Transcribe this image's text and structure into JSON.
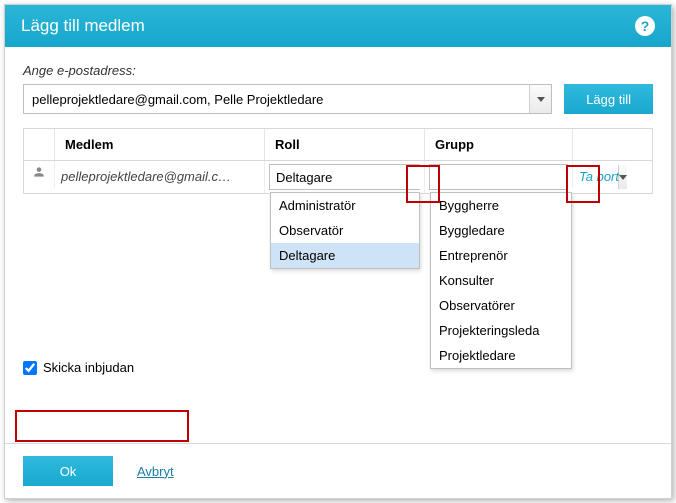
{
  "dialog": {
    "title": "Lägg till medlem",
    "help_icon": "?"
  },
  "email": {
    "label": "Ange e-postadress:",
    "value": "pelleprojektledare@gmail.com, Pelle Projektledare",
    "add_button": "Lägg till"
  },
  "table": {
    "headers": {
      "member": "Medlem",
      "role": "Roll",
      "group": "Grupp"
    },
    "row": {
      "member": "pelleprojektledare@gmail.c…",
      "role_value": "Deltagare",
      "group_value": "",
      "remove": "Ta bort"
    }
  },
  "role_options": [
    "Administratör",
    "Observatör",
    "Deltagare"
  ],
  "role_selected_index": 2,
  "group_options": [
    "Byggherre",
    "Byggledare",
    "Entreprenör",
    "Konsulter",
    "Observatörer",
    "Projekteringsleda",
    "Projektledare"
  ],
  "send_invite": {
    "label": "Skicka inbjudan",
    "checked": true
  },
  "footer": {
    "ok": "Ok",
    "cancel": "Avbryt"
  }
}
